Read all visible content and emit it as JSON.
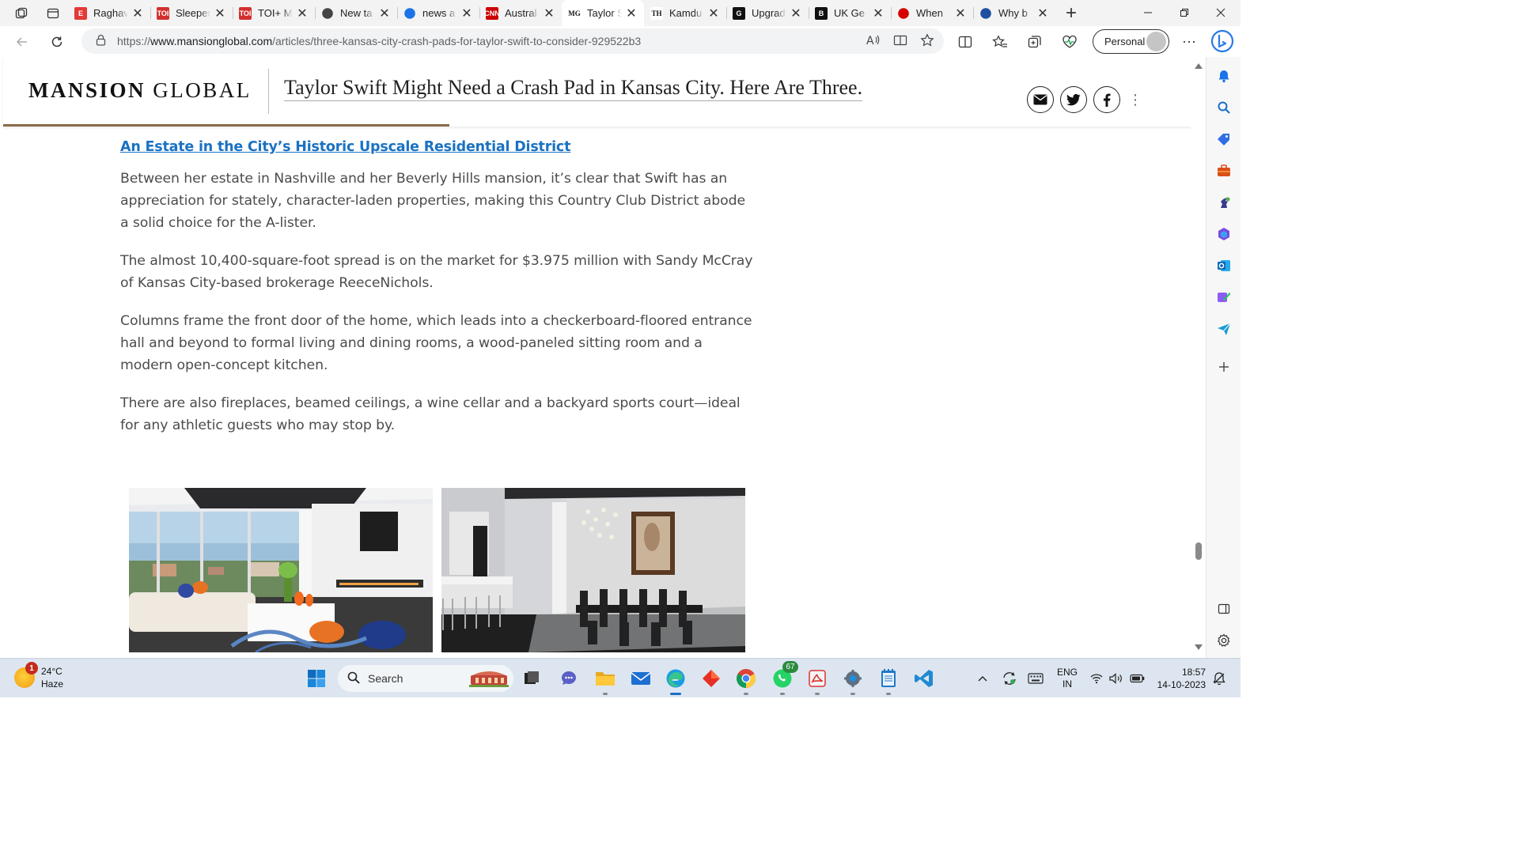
{
  "browser": {
    "tabs": [
      {
        "title": "Raghav",
        "favicon_label": "E",
        "favicon_color": "#e53935"
      },
      {
        "title": "Sleeper",
        "favicon_label": "TOI",
        "favicon_color": "#d32f2f"
      },
      {
        "title": "TOI+ M",
        "favicon_label": "TOI",
        "favicon_color": "#d32f2f"
      },
      {
        "title": "New ta",
        "favicon_label": "",
        "favicon_color": "#444444"
      },
      {
        "title": "news a",
        "favicon_label": "",
        "favicon_color": "#1a73e8"
      },
      {
        "title": "Austral",
        "favicon_label": "CNN",
        "favicon_color": "#cc0000"
      },
      {
        "title": "Taylor S",
        "favicon_label": "MG",
        "favicon_color": "#ffffff"
      },
      {
        "title": "Kamdu",
        "favicon_label": "TH",
        "favicon_color": "#ffffff"
      },
      {
        "title": "Upgrad",
        "favicon_label": "G",
        "favicon_color": "#111111"
      },
      {
        "title": "UK Ge",
        "favicon_label": "B",
        "favicon_color": "#111111"
      },
      {
        "title": "When",
        "favicon_label": "",
        "favicon_color": "#d50000"
      },
      {
        "title": "Why b",
        "favicon_label": "",
        "favicon_color": "#1e4fa0"
      }
    ],
    "active_tab_index": 6,
    "url_prefix": "https://",
    "url_host": "www.mansionglobal.com",
    "url_path": "/articles/three-kansas-city-crash-pads-for-taylor-swift-to-consider-929522b3",
    "profile_label": "Personal"
  },
  "site": {
    "brand_bold": "MANSION",
    "brand_light": " GLOBAL",
    "headline": "Taylor Swift Might Need a Crash Pad in Kansas City. Here Are Three."
  },
  "article": {
    "section_heading": "An Estate in the City’s Historic Upscale Residential District",
    "paragraphs": [
      "Between her estate in Nashville and her Beverly Hills mansion, it’s clear that Swift has an appreciation for stately, character-laden properties, making this Country Club District abode a solid choice for the A-lister.",
      "The almost 10,400-square-foot spread is on the market for $3.975 million with Sandy McCray of Kansas City-based brokerage ReeceNichols.",
      "Columns frame the front door of the home, which leads into a checkerboard-floored entrance hall and beyond to formal living and dining rooms, a wood-paneled sitting room and a modern open-concept kitchen.",
      "There are also fireplaces, beamed ceilings, a wine cellar and a backyard sports court—ideal for any athletic guests who may stop by."
    ]
  },
  "taskbar": {
    "weather_temp": "24°C",
    "weather_desc": "Haze",
    "weather_badge": "1",
    "search_placeholder": "Search",
    "whatsapp_badge": "67",
    "lang_primary": "ENG",
    "lang_secondary": "IN",
    "time": "18:57",
    "date": "14-10-2023"
  }
}
